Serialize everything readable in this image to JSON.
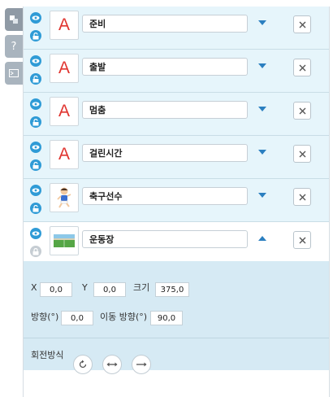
{
  "side_tabs": [
    {
      "icon": "objects-icon"
    },
    {
      "icon": "help-icon",
      "label": "?"
    },
    {
      "icon": "console-icon"
    }
  ],
  "objects": [
    {
      "name": "준비",
      "thumb_type": "text",
      "thumb_letter": "A",
      "locked": false,
      "expanded": false
    },
    {
      "name": "출발",
      "thumb_type": "text",
      "thumb_letter": "A",
      "locked": false,
      "expanded": false
    },
    {
      "name": "멈춤",
      "thumb_type": "text",
      "thumb_letter": "A",
      "locked": false,
      "expanded": false
    },
    {
      "name": "걸린시간",
      "thumb_type": "text",
      "thumb_letter": "A",
      "locked": false,
      "expanded": false
    },
    {
      "name": "축구선수",
      "thumb_type": "sprite",
      "locked": false,
      "expanded": false
    },
    {
      "name": "운동장",
      "thumb_type": "image",
      "locked": true,
      "expanded": true
    }
  ],
  "properties": {
    "x_label": "X",
    "x_value": "0,0",
    "y_label": "Y",
    "y_value": "0,0",
    "size_label": "크기",
    "size_value": "375,0",
    "direction_label": "방향(°)",
    "direction_value": "0,0",
    "move_direction_label": "이동 방향(°)",
    "move_direction_value": "90,0",
    "rotation_label": "회전방식"
  },
  "colors": {
    "accent": "#2f9bd6",
    "row_bg": "#e6f5fb",
    "props_bg": "#d6eaf4",
    "text_icon": "#e0342f"
  }
}
